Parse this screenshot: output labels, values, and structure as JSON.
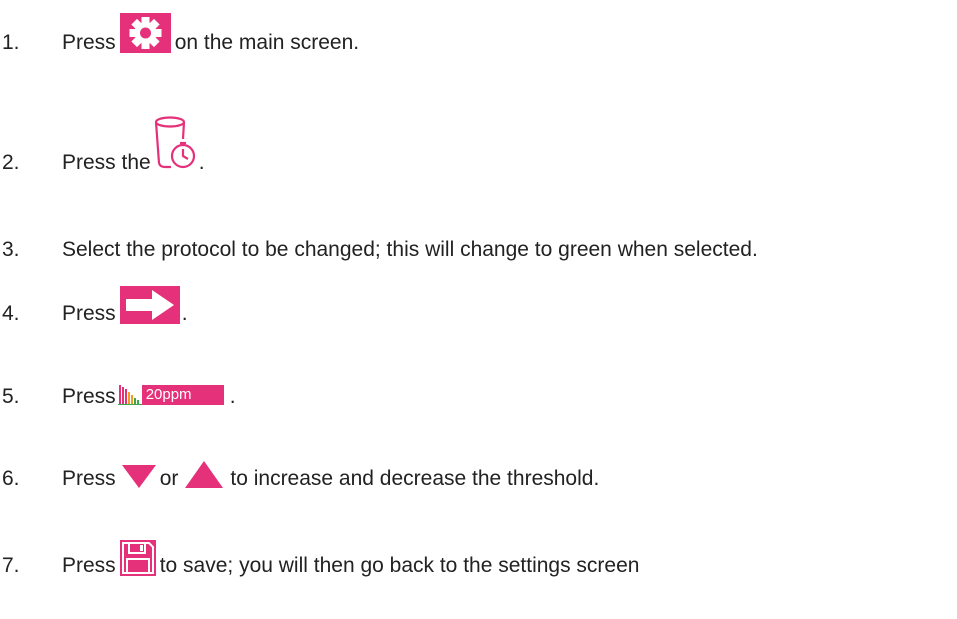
{
  "steps": [
    {
      "number": "1.",
      "before": "Press",
      "after": "on the main screen.",
      "icon": "gear-icon"
    },
    {
      "number": "2.",
      "before": "Press the",
      "after": ".",
      "icon": "bin-timer-icon"
    },
    {
      "number": "3.",
      "text": "Select the protocol to be changed; this will change to green when selected."
    },
    {
      "number": "4.",
      "before": "Press",
      "after": ".",
      "icon": "arrow-right-icon"
    },
    {
      "number": "5.",
      "before": "Press",
      "after": ".",
      "icon": "bar-chart-icon",
      "chip_label": "20ppm"
    },
    {
      "number": "6.",
      "before": "Press",
      "middle": "or",
      "after": "to increase and decrease the threshold.",
      "icons": [
        "triangle-down-icon",
        "triangle-up-icon"
      ]
    },
    {
      "number": "7.",
      "before": "Press",
      "after": "to save; you will then go back to the settings screen",
      "icon": "floppy-disk-icon"
    }
  ],
  "colors": {
    "accent": "#e5307a",
    "text": "#222222",
    "background": "#ffffff",
    "bar_colors": [
      "#e5307a",
      "#f0a020",
      "#3aa84a"
    ]
  }
}
